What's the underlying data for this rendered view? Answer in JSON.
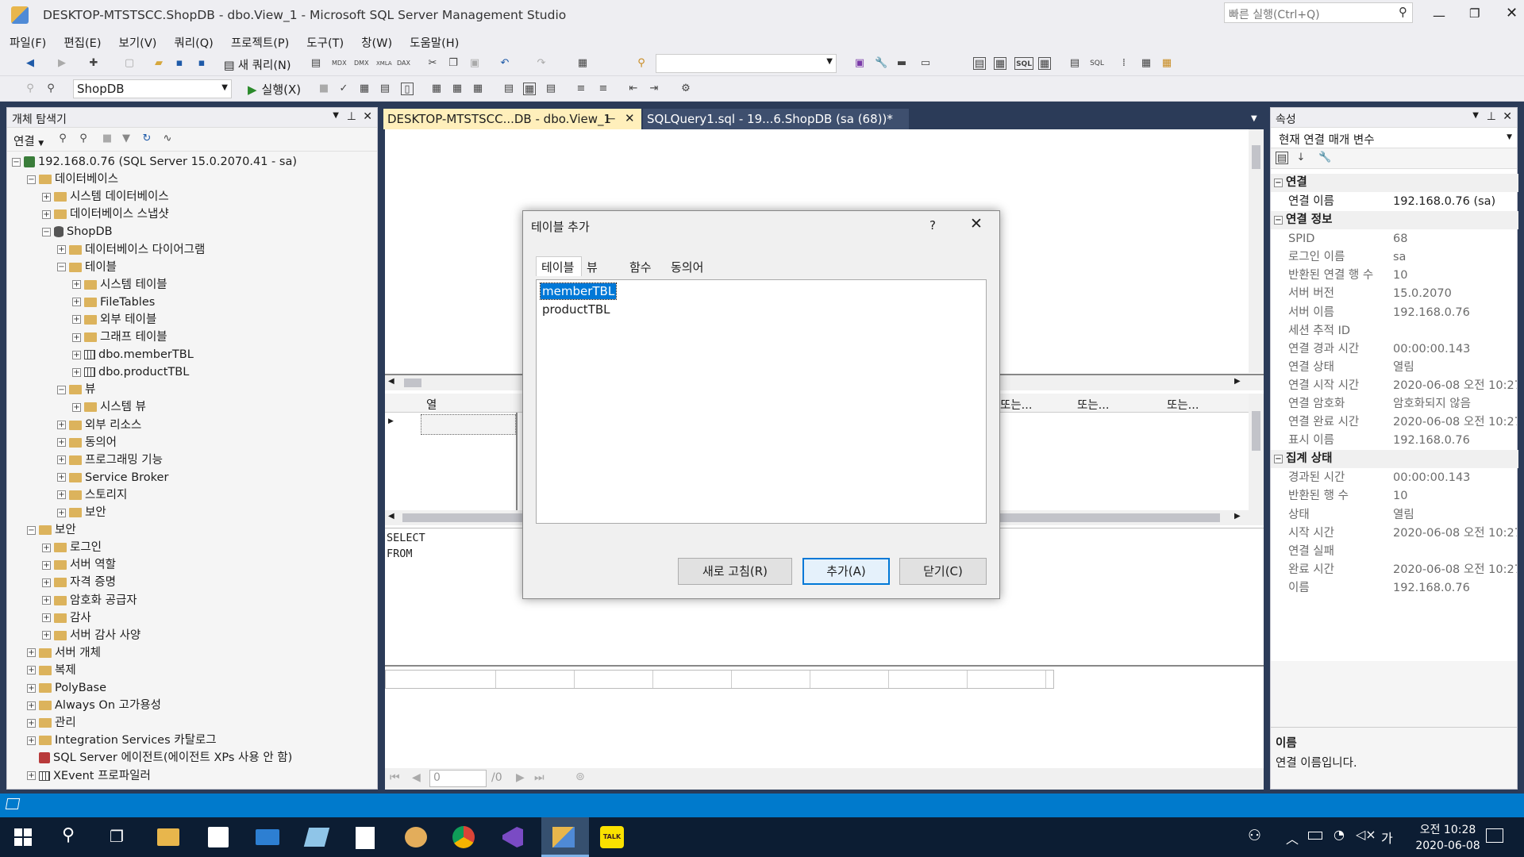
{
  "titlebar": {
    "title": "DESKTOP-MTSTSCC.ShopDB - dbo.View_1 - Microsoft SQL Server Management Studio",
    "quick_launch": "빠른 실행(Ctrl+Q)"
  },
  "menu": [
    "파일(F)",
    "편집(E)",
    "보기(V)",
    "쿼리(Q)",
    "프로젝트(P)",
    "도구(T)",
    "창(W)",
    "도움말(H)"
  ],
  "toolbar1": {
    "new_query": "새 쿼리(N)",
    "mdx": "MDX",
    "dmx": "DMX",
    "xmla": "XMLA",
    "dax": "DAX",
    "sql": "SQL"
  },
  "toolbar2": {
    "db_select": "ShopDB",
    "execute": "실행(X)"
  },
  "object_explorer": {
    "title": "개체 탐색기",
    "connect": "연결",
    "nodes": [
      {
        "text": "192.168.0.76 (SQL Server 15.0.2070.41 - sa)",
        "level": 0,
        "toggle": "−",
        "icon": "server"
      },
      {
        "text": "데이터베이스",
        "level": 1,
        "toggle": "−",
        "icon": "folder"
      },
      {
        "text": "시스템 데이터베이스",
        "level": 2,
        "toggle": "+",
        "icon": "folder"
      },
      {
        "text": "데이터베이스 스냅샷",
        "level": 2,
        "toggle": "+",
        "icon": "folder"
      },
      {
        "text": "ShopDB",
        "level": 2,
        "toggle": "−",
        "icon": "db"
      },
      {
        "text": "데이터베이스 다이어그램",
        "level": 3,
        "toggle": "+",
        "icon": "folder"
      },
      {
        "text": "테이블",
        "level": 3,
        "toggle": "−",
        "icon": "folder"
      },
      {
        "text": "시스템 테이블",
        "level": 4,
        "toggle": "+",
        "icon": "folder"
      },
      {
        "text": "FileTables",
        "level": 4,
        "toggle": "+",
        "icon": "folder"
      },
      {
        "text": "외부 테이블",
        "level": 4,
        "toggle": "+",
        "icon": "folder"
      },
      {
        "text": "그래프 테이블",
        "level": 4,
        "toggle": "+",
        "icon": "folder"
      },
      {
        "text": "dbo.memberTBL",
        "level": 4,
        "toggle": "+",
        "icon": "table"
      },
      {
        "text": "dbo.productTBL",
        "level": 4,
        "toggle": "+",
        "icon": "table"
      },
      {
        "text": "뷰",
        "level": 3,
        "toggle": "−",
        "icon": "folder"
      },
      {
        "text": "시스템 뷰",
        "level": 4,
        "toggle": "+",
        "icon": "folder"
      },
      {
        "text": "외부 리소스",
        "level": 3,
        "toggle": "+",
        "icon": "folder"
      },
      {
        "text": "동의어",
        "level": 3,
        "toggle": "+",
        "icon": "folder"
      },
      {
        "text": "프로그래밍 기능",
        "level": 3,
        "toggle": "+",
        "icon": "folder"
      },
      {
        "text": "Service Broker",
        "level": 3,
        "toggle": "+",
        "icon": "folder"
      },
      {
        "text": "스토리지",
        "level": 3,
        "toggle": "+",
        "icon": "folder"
      },
      {
        "text": "보안",
        "level": 3,
        "toggle": "+",
        "icon": "folder"
      },
      {
        "text": "보안",
        "level": 1,
        "toggle": "−",
        "icon": "folder"
      },
      {
        "text": "로그인",
        "level": 2,
        "toggle": "+",
        "icon": "folder"
      },
      {
        "text": "서버 역할",
        "level": 2,
        "toggle": "+",
        "icon": "folder"
      },
      {
        "text": "자격 증명",
        "level": 2,
        "toggle": "+",
        "icon": "folder"
      },
      {
        "text": "암호화 공급자",
        "level": 2,
        "toggle": "+",
        "icon": "folder"
      },
      {
        "text": "감사",
        "level": 2,
        "toggle": "+",
        "icon": "folder"
      },
      {
        "text": "서버 감사 사양",
        "level": 2,
        "toggle": "+",
        "icon": "folder"
      },
      {
        "text": "서버 개체",
        "level": 1,
        "toggle": "+",
        "icon": "folder"
      },
      {
        "text": "복제",
        "level": 1,
        "toggle": "+",
        "icon": "folder"
      },
      {
        "text": "PolyBase",
        "level": 1,
        "toggle": "+",
        "icon": "folder"
      },
      {
        "text": "Always On 고가용성",
        "level": 1,
        "toggle": "+",
        "icon": "folder"
      },
      {
        "text": "관리",
        "level": 1,
        "toggle": "+",
        "icon": "folder"
      },
      {
        "text": "Integration Services 카탈로그",
        "level": 1,
        "toggle": "+",
        "icon": "folder"
      },
      {
        "text": "SQL Server 에이전트(에이전트 XPs 사용 안 함)",
        "level": 1,
        "toggle": "",
        "icon": "agent"
      },
      {
        "text": "XEvent 프로파일러",
        "level": 1,
        "toggle": "+",
        "icon": "xevent"
      }
    ]
  },
  "tabs": {
    "active": "DESKTOP-MTSTSCC...DB - dbo.View_1",
    "inactive": "SQLQuery1.sql - 19...6.ShopDB (sa (68))*"
  },
  "grid": {
    "col_header": "열",
    "or_headers": [
      "또는...",
      "또는...",
      "또는..."
    ]
  },
  "sql_pane": {
    "line1": "SELECT",
    "line2": "FROM"
  },
  "nav": {
    "page": "0",
    "total": "/0"
  },
  "dialog": {
    "title": "테이블 추가",
    "help": "?",
    "tabs": [
      "테이블",
      "뷰",
      "함수",
      "동의어"
    ],
    "items": [
      "memberTBL",
      "productTBL"
    ],
    "btn_refresh": "새로 고침(R)",
    "btn_add": "추가(A)",
    "btn_close": "닫기(C)"
  },
  "properties": {
    "title": "속성",
    "selector": "현재 연결 매개 변수",
    "cat_connection": "연결",
    "cat_info": "연결 정보",
    "cat_aggregate": "집계 상태",
    "conn_rows": [
      {
        "k": "연결 이름",
        "v": "192.168.0.76 (sa)"
      }
    ],
    "info_rows": [
      {
        "k": "SPID",
        "v": "68"
      },
      {
        "k": "로그인 이름",
        "v": "sa"
      },
      {
        "k": "반환된 연결 행 수",
        "v": "10"
      },
      {
        "k": "서버 버전",
        "v": "15.0.2070"
      },
      {
        "k": "서버 이름",
        "v": "192.168.0.76"
      },
      {
        "k": "세션 추적 ID",
        "v": ""
      },
      {
        "k": "연결 경과 시간",
        "v": "00:00:00.143"
      },
      {
        "k": "연결 상태",
        "v": "열림"
      },
      {
        "k": "연결 시작 시간",
        "v": "2020-06-08 오전 10:27:"
      },
      {
        "k": "연결 암호화",
        "v": "암호화되지 않음"
      },
      {
        "k": "연결 완료 시간",
        "v": "2020-06-08 오전 10:27:"
      },
      {
        "k": "표시 이름",
        "v": "192.168.0.76"
      }
    ],
    "agg_rows": [
      {
        "k": "경과된 시간",
        "v": "00:00:00.143"
      },
      {
        "k": "반환된 행 수",
        "v": "10"
      },
      {
        "k": "상태",
        "v": "열림"
      },
      {
        "k": "시작 시간",
        "v": "2020-06-08 오전 10:27:"
      },
      {
        "k": "연결 실패",
        "v": ""
      },
      {
        "k": "완료 시간",
        "v": "2020-06-08 오전 10:27:"
      },
      {
        "k": "이름",
        "v": "192.168.0.76"
      }
    ],
    "desc_title": "이름",
    "desc_text": "연결 이름입니다."
  },
  "taskbar": {
    "time": "오전 10:28",
    "date": "2020-06-08",
    "ime": "가",
    "kakao": "TALK"
  }
}
